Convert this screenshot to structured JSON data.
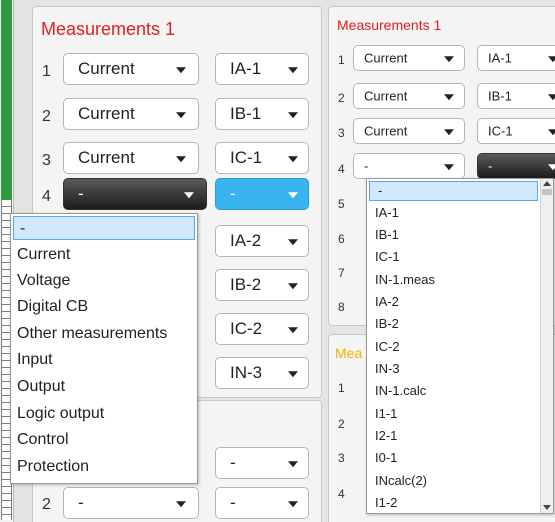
{
  "panel_left": {
    "title": "Measurements 1",
    "rows": [
      {
        "num": "1",
        "type": "Current",
        "signal": "IA-1"
      },
      {
        "num": "2",
        "type": "Current",
        "signal": "IB-1"
      },
      {
        "num": "3",
        "type": "Current",
        "signal": "IC-1"
      },
      {
        "num": "4",
        "type": "-",
        "signal": "-"
      }
    ],
    "hidden_rows_signals": [
      "IA-2",
      "IB-2",
      "IC-2",
      "IN-3"
    ]
  },
  "panel_left_lower": {
    "rows": [
      {
        "signal": "-"
      },
      {
        "num": "2",
        "type": "-",
        "signal": "-"
      }
    ]
  },
  "panel_right": {
    "title": "Measurements 1",
    "rows": [
      {
        "num": "1",
        "type": "Current",
        "signal": "IA-1"
      },
      {
        "num": "2",
        "type": "Current",
        "signal": "IB-1"
      },
      {
        "num": "3",
        "type": "Current",
        "signal": "IC-1"
      },
      {
        "num": "4",
        "type": "-",
        "signal": "-"
      }
    ],
    "hidden_row_nums": [
      "5",
      "6",
      "7",
      "8"
    ]
  },
  "panel_right_lower": {
    "title_partial": "Mea",
    "row_nums": [
      "1",
      "2",
      "3",
      "4"
    ]
  },
  "type_dropdown": {
    "items": [
      "-",
      "Current",
      "Voltage",
      "Digital CB",
      "Other measurements",
      "Input",
      "Output",
      "Logic output",
      "Control",
      "Protection"
    ],
    "highlighted": "-"
  },
  "signal_dropdown": {
    "items": [
      "-",
      "IA-1",
      "IB-1",
      "IC-1",
      "IN-1.meas",
      "IA-2",
      "IB-2",
      "IC-2",
      "IN-3",
      "IN-1.calc",
      "I1-1",
      "I2-1",
      "I0-1",
      "INcalc(2)",
      "I1-2"
    ],
    "highlighted": "-"
  },
  "colors": {
    "title_red": "#e02020",
    "title_yellow": "#f0b400",
    "active_blue": "#3ab4ee",
    "active_dark": "#2a2a2a",
    "strip_green": "#2e9b3e"
  }
}
